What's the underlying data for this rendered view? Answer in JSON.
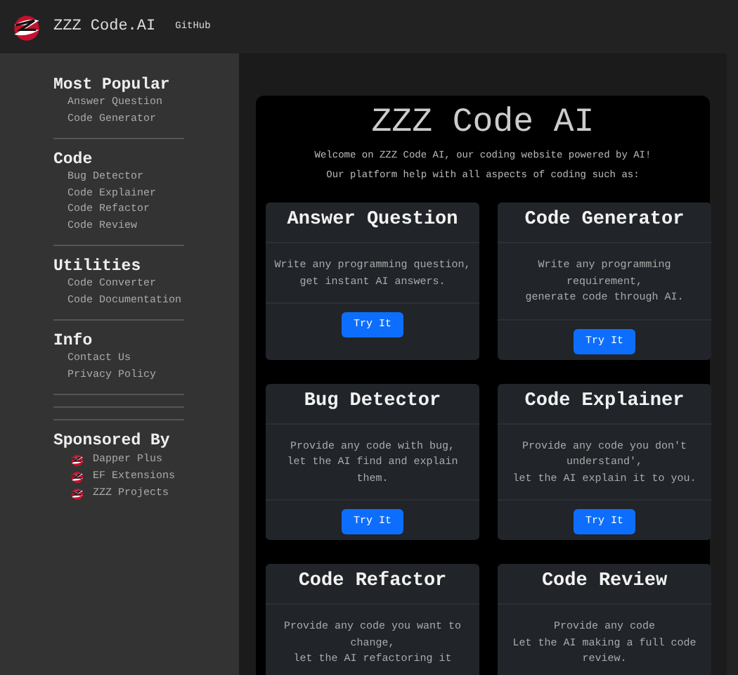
{
  "header": {
    "brand": "ZZZ Code.AI",
    "links": [
      "GitHub"
    ]
  },
  "sidebar": {
    "sections": [
      {
        "title": "Most Popular",
        "items": [
          "Answer Question",
          "Code Generator"
        ]
      },
      {
        "title": "Code",
        "items": [
          "Bug Detector",
          "Code Explainer",
          "Code Refactor",
          "Code Review"
        ]
      },
      {
        "title": "Utilities",
        "items": [
          "Code Converter",
          "Code Documentation"
        ]
      },
      {
        "title": "Info",
        "items": [
          "Contact Us",
          "Privacy Policy"
        ]
      }
    ],
    "sponsors": {
      "title": "Sponsored By",
      "items": [
        "Dapper Plus",
        "EF Extensions",
        "ZZZ Projects"
      ]
    }
  },
  "main": {
    "title": "ZZZ Code AI",
    "intro": [
      "Welcome on ZZZ Code AI, our coding website powered by AI!",
      "Our platform help with all aspects of coding such as:"
    ],
    "cards": [
      {
        "title": "Answer Question",
        "lines": [
          "Write any programming question,",
          "get instant AI answers."
        ],
        "button": "Try It"
      },
      {
        "title": "Code Generator",
        "lines": [
          "Write any programming requirement,",
          "generate code through AI."
        ],
        "button": "Try It"
      },
      {
        "title": "Bug Detector",
        "lines": [
          "Provide any code with bug,",
          "let the AI find and explain them."
        ],
        "button": "Try It"
      },
      {
        "title": "Code Explainer",
        "lines": [
          "Provide any code you don't understand',",
          "let the AI explain it to you."
        ],
        "button": "Try It"
      },
      {
        "title": "Code Refactor",
        "lines": [
          "Provide any code you want to change,",
          "let the AI refactoring it"
        ]
      },
      {
        "title": "Code Review",
        "lines": [
          "Provide any code",
          "Let the AI making a full code review."
        ]
      }
    ]
  }
}
